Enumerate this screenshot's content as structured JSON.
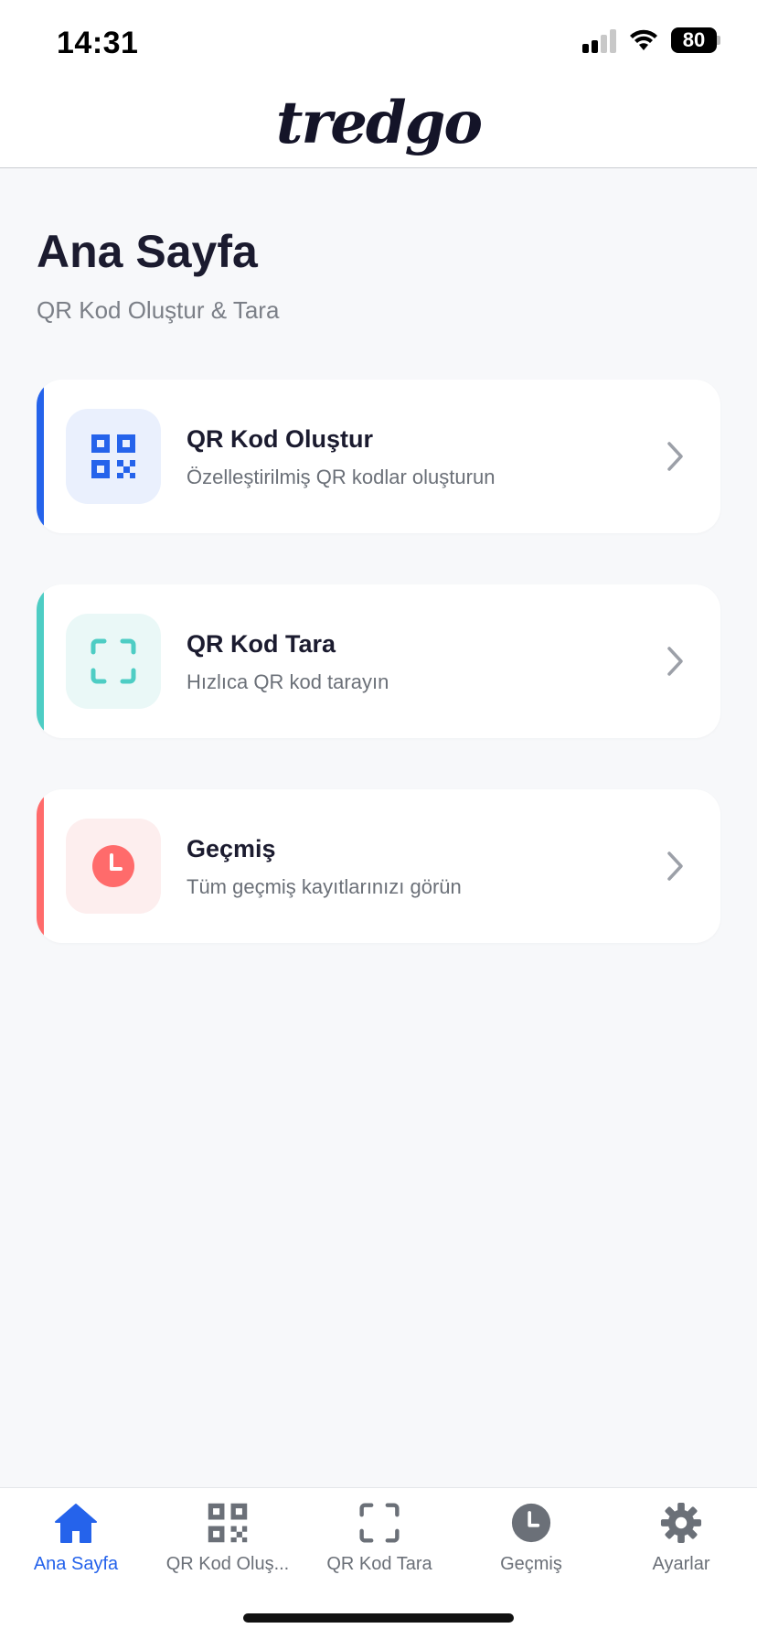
{
  "status_bar": {
    "time": "14:31",
    "battery": "80"
  },
  "header": {
    "logo": "tredgo"
  },
  "page": {
    "title": "Ana Sayfa",
    "subtitle": "QR Kod Oluştur & Tara"
  },
  "cards": [
    {
      "title": "QR Kod Oluştur",
      "description": "Özelleştirilmiş QR kodlar oluşturun",
      "icon": "qr-code-icon",
      "accent": "#2563eb",
      "icon_bg": "#eaf0fd",
      "icon_color": "#2563eb"
    },
    {
      "title": "QR Kod Tara",
      "description": "Hızlıca QR kod tarayın",
      "icon": "scan-frame-icon",
      "accent": "#4ecdc4",
      "icon_bg": "#eaf8f7",
      "icon_color": "#4ecdc4"
    },
    {
      "title": "Geçmiş",
      "description": "Tüm geçmiş kayıtlarınızı görün",
      "icon": "clock-icon",
      "accent": "#ff6b6b",
      "icon_bg": "#fdeeee",
      "icon_color": "#ff6b6b"
    }
  ],
  "tab_bar": {
    "items": [
      {
        "label": "Ana Sayfa",
        "icon": "home-icon",
        "active": true
      },
      {
        "label": "QR Kod Oluş...",
        "icon": "qr-code-icon",
        "active": false
      },
      {
        "label": "QR Kod Tara",
        "icon": "scan-frame-icon",
        "active": false
      },
      {
        "label": "Geçmiş",
        "icon": "clock-icon",
        "active": false
      },
      {
        "label": "Ayarlar",
        "icon": "gear-icon",
        "active": false
      }
    ]
  },
  "colors": {
    "active_tab": "#2563eb",
    "inactive_tab": "#6b7078",
    "background": "#f7f8fa"
  }
}
